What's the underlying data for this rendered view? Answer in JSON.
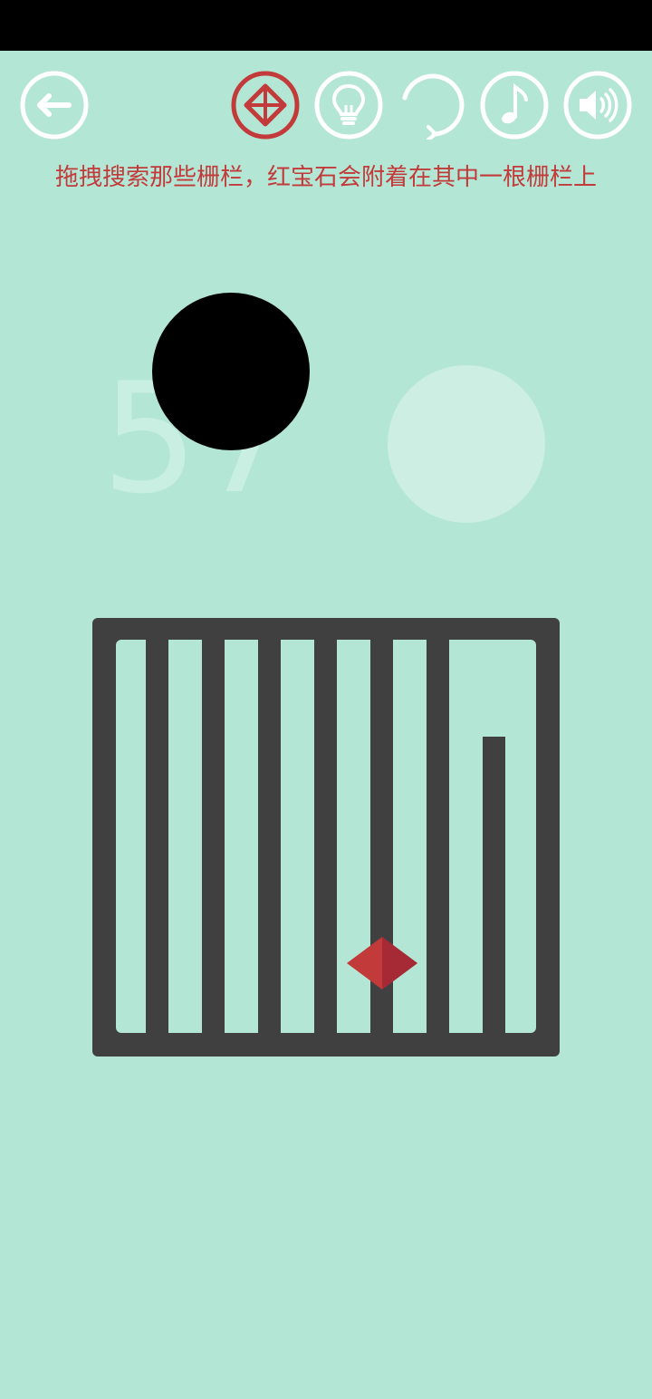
{
  "hud": {
    "back_icon": "arrow-left-icon",
    "gem_icon": "gem-target-icon",
    "hint_icon": "lightbulb-icon",
    "restart_icon": "restart-icon",
    "music_icon": "music-note-icon",
    "sound_icon": "speaker-icon"
  },
  "hint": {
    "text": "拖拽搜索那些栅栏，红宝石会附着在其中一根栅栏上"
  },
  "level": {
    "number": "57"
  },
  "colors": {
    "background": "#b3e6d5",
    "cage": "#404040",
    "gem": "#c23a3a",
    "hint_text": "#c23a3a",
    "icon_white": "#ffffff"
  }
}
